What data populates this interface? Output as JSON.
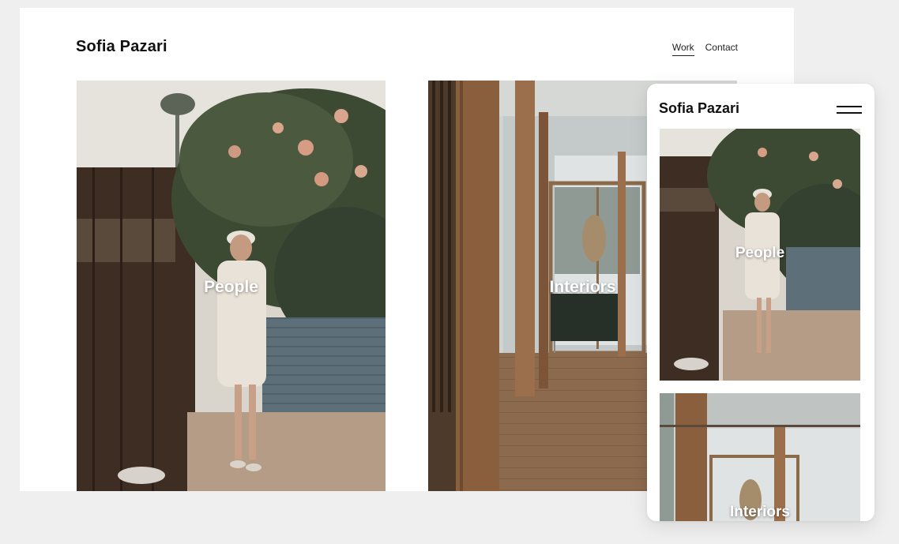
{
  "desktop": {
    "brand": "Sofia Pazari",
    "nav": [
      {
        "label": "Work",
        "active": true
      },
      {
        "label": "Contact",
        "active": false
      }
    ],
    "tiles": [
      {
        "caption": "People"
      },
      {
        "caption": "Interiors"
      }
    ]
  },
  "mobile": {
    "brand": "Sofia Pazari",
    "menu_icon": "hamburger-menu-icon",
    "tiles": [
      {
        "caption": "People"
      },
      {
        "caption": "Interiors"
      }
    ]
  },
  "colors": {
    "page_background": "#efefef",
    "frame_background": "#ffffff",
    "text": "#111111"
  }
}
